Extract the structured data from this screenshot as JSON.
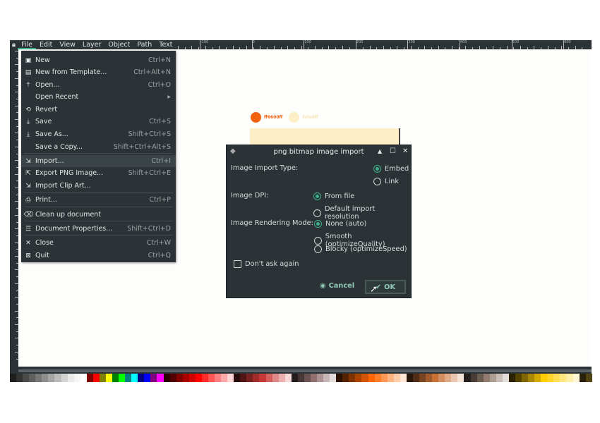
{
  "menubar": {
    "items": [
      "File",
      "Edit",
      "View",
      "Layer",
      "Object",
      "Path",
      "Text"
    ],
    "active": "File"
  },
  "ruler": {
    "labels": [
      "-100",
      "0",
      "100",
      "200",
      "300",
      "400",
      "500",
      "600"
    ]
  },
  "file_menu": {
    "items": [
      {
        "icon": "new-doc-icon",
        "glyph": "▣",
        "label": "New",
        "shortcut": "Ctrl+N"
      },
      {
        "icon": "template-icon",
        "glyph": "▤",
        "label": "New from Template...",
        "shortcut": "Ctrl+Alt+N"
      },
      {
        "icon": "open-icon",
        "glyph": "⤒",
        "label": "Open...",
        "shortcut": "Ctrl+O"
      },
      {
        "icon": "",
        "glyph": "",
        "label": "Open Recent",
        "shortcut": "▸"
      },
      {
        "icon": "revert-icon",
        "glyph": "⟲",
        "label": "Revert",
        "shortcut": ""
      },
      {
        "icon": "save-icon",
        "glyph": "⤓",
        "label": "Save",
        "shortcut": "Ctrl+S"
      },
      {
        "icon": "save-as-icon",
        "glyph": "⤓",
        "label": "Save As...",
        "shortcut": "Shift+Ctrl+S"
      },
      {
        "icon": "",
        "glyph": "",
        "label": "Save a Copy...",
        "shortcut": "Shift+Ctrl+Alt+S"
      },
      {
        "icon": "import-icon",
        "glyph": "⇲",
        "label": "Import...",
        "shortcut": "Ctrl+I"
      },
      {
        "icon": "export-icon",
        "glyph": "⇱",
        "label": "Export PNG Image...",
        "shortcut": "Shift+Ctrl+E"
      },
      {
        "icon": "clip-art-icon",
        "glyph": "⇲",
        "label": "Import Clip Art...",
        "shortcut": ""
      },
      {
        "icon": "print-icon",
        "glyph": "⎙",
        "label": "Print...",
        "shortcut": "Ctrl+P"
      },
      {
        "icon": "clean-up-icon",
        "glyph": "⌫",
        "label": "Clean up document",
        "shortcut": ""
      },
      {
        "icon": "properties-icon",
        "glyph": "☰",
        "label": "Document Properties...",
        "shortcut": "Shift+Ctrl+D"
      },
      {
        "icon": "close-icon",
        "glyph": "✕",
        "label": "Close",
        "shortcut": "Ctrl+W"
      },
      {
        "icon": "quit-icon",
        "glyph": "⊠",
        "label": "Quit",
        "shortcut": "Ctrl+Q"
      }
    ],
    "highlighted": "Import..."
  },
  "canvas": {
    "swatch1": {
      "label": "ff6600ff",
      "color": "#f26110"
    },
    "swatch2": {
      "label": "fefe0ff",
      "color": "#fdeec5"
    }
  },
  "dialog": {
    "title": "png bitmap image import",
    "import_type": {
      "label": "Image Import Type:",
      "options": [
        "Embed",
        "Link"
      ],
      "selected": "Embed"
    },
    "dpi": {
      "label": "Image DPI:",
      "options": [
        "From file",
        "Default import resolution"
      ],
      "selected": "From file"
    },
    "rendering": {
      "label": "Image Rendering Mode:",
      "options": [
        "None (auto)",
        "Smooth (optimizeQuality)",
        "Blocky (optimizeSpeed)"
      ],
      "selected": "None (auto)"
    },
    "dont_ask": {
      "label": "Don't ask again",
      "checked": false
    },
    "cancel": "Cancel",
    "ok": "OK"
  },
  "accent": "#3daf8a",
  "palette": [
    "#1e1e1e",
    "#333",
    "#4a4a4a",
    "#606060",
    "#777",
    "#8e8e8e",
    "#a5a5a5",
    "#bcbcbc",
    "#d3d3d3",
    "#e9e9e9",
    "#f6f6f6",
    "#fff",
    "#800000",
    "#ff0000",
    "#808000",
    "#ffff00",
    "#008000",
    "#00ff00",
    "#008080",
    "#00ffff",
    "#000080",
    "#0000ff",
    "#800080",
    "#ff00ff",
    "#2b0000",
    "#550000",
    "#800000",
    "#aa0000",
    "#d40000",
    "#ff0000",
    "#ff2a2a",
    "#ff5555",
    "#ff8080",
    "#ffaaaa",
    "#ffd5d5",
    "#280b0b",
    "#501616",
    "#782121",
    "#a02c2c",
    "#c83737",
    "#d35f5f",
    "#de8787",
    "#e9afaf",
    "#f4d7d7",
    "#241c1c",
    "#483737",
    "#6c5353",
    "#916f6f",
    "#ac9393",
    "#c8b7b7",
    "#e3dbdb",
    "#2b1100",
    "#552200",
    "#803300",
    "#aa4400",
    "#d45500",
    "#ff6600",
    "#ff7f2a",
    "#ff9955",
    "#ffb380",
    "#ffccaa",
    "#ffe6d5",
    "#28170b",
    "#502d16",
    "#784421",
    "#a05a2c",
    "#c87137",
    "#d38d5f",
    "#deaa87",
    "#e9c6af",
    "#f4e3d7",
    "#241f1c",
    "#483e37",
    "#6c5d53",
    "#917c6f",
    "#ac9d93",
    "#c8beb7",
    "#e3dedb",
    "#2b2200",
    "#554400",
    "#806600",
    "#aa8800",
    "#d4aa00",
    "#ffcc00",
    "#ffd42a",
    "#ffdd55",
    "#ffe680",
    "#ffeeaa",
    "#fff6d5",
    "#28220b",
    "#504416"
  ]
}
